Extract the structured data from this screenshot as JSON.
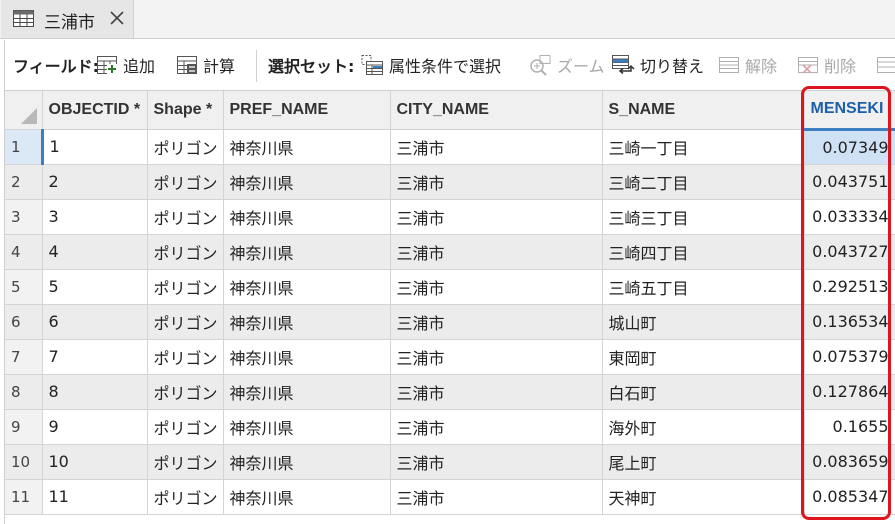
{
  "tab": {
    "title": "三浦市",
    "icon": "table-icon"
  },
  "toolbar": {
    "field_label": "フィールド:",
    "add_label": "追加",
    "calc_label": "計算",
    "selection_label": "選択セット:",
    "select_by_attr_label": "属性条件で選択",
    "zoom_label": "ズーム",
    "switch_label": "切り替え",
    "clear_label": "解除",
    "delete_label": "削除"
  },
  "table": {
    "columns": [
      "OBJECTID *",
      "Shape *",
      "PREF_NAME",
      "CITY_NAME",
      "S_NAME",
      "MENSEKI"
    ],
    "rows": [
      {
        "n": "1",
        "oid": "1",
        "shape": "ポリゴン",
        "pref": "神奈川県",
        "city": "三浦市",
        "sname": "三崎一丁目",
        "menseki": "0.07349"
      },
      {
        "n": "2",
        "oid": "2",
        "shape": "ポリゴン",
        "pref": "神奈川県",
        "city": "三浦市",
        "sname": "三崎二丁目",
        "menseki": "0.043751"
      },
      {
        "n": "3",
        "oid": "3",
        "shape": "ポリゴン",
        "pref": "神奈川県",
        "city": "三浦市",
        "sname": "三崎三丁目",
        "menseki": "0.033334"
      },
      {
        "n": "4",
        "oid": "4",
        "shape": "ポリゴン",
        "pref": "神奈川県",
        "city": "三浦市",
        "sname": "三崎四丁目",
        "menseki": "0.043727"
      },
      {
        "n": "5",
        "oid": "5",
        "shape": "ポリゴン",
        "pref": "神奈川県",
        "city": "三浦市",
        "sname": "三崎五丁目",
        "menseki": "0.292513"
      },
      {
        "n": "6",
        "oid": "6",
        "shape": "ポリゴン",
        "pref": "神奈川県",
        "city": "三浦市",
        "sname": "城山町",
        "menseki": "0.136534"
      },
      {
        "n": "7",
        "oid": "7",
        "shape": "ポリゴン",
        "pref": "神奈川県",
        "city": "三浦市",
        "sname": "東岡町",
        "menseki": "0.075379"
      },
      {
        "n": "8",
        "oid": "8",
        "shape": "ポリゴン",
        "pref": "神奈川県",
        "city": "三浦市",
        "sname": "白石町",
        "menseki": "0.127864"
      },
      {
        "n": "9",
        "oid": "9",
        "shape": "ポリゴン",
        "pref": "神奈川県",
        "city": "三浦市",
        "sname": "海外町",
        "menseki": "0.1655"
      },
      {
        "n": "10",
        "oid": "10",
        "shape": "ポリゴン",
        "pref": "神奈川県",
        "city": "三浦市",
        "sname": "尾上町",
        "menseki": "0.083659"
      },
      {
        "n": "11",
        "oid": "11",
        "shape": "ポリゴン",
        "pref": "神奈川県",
        "city": "三浦市",
        "sname": "天神町",
        "menseki": "0.085347"
      }
    ]
  },
  "colors": {
    "highlight_box": "#e0141e",
    "selection_accent": "#3d7ec3"
  }
}
